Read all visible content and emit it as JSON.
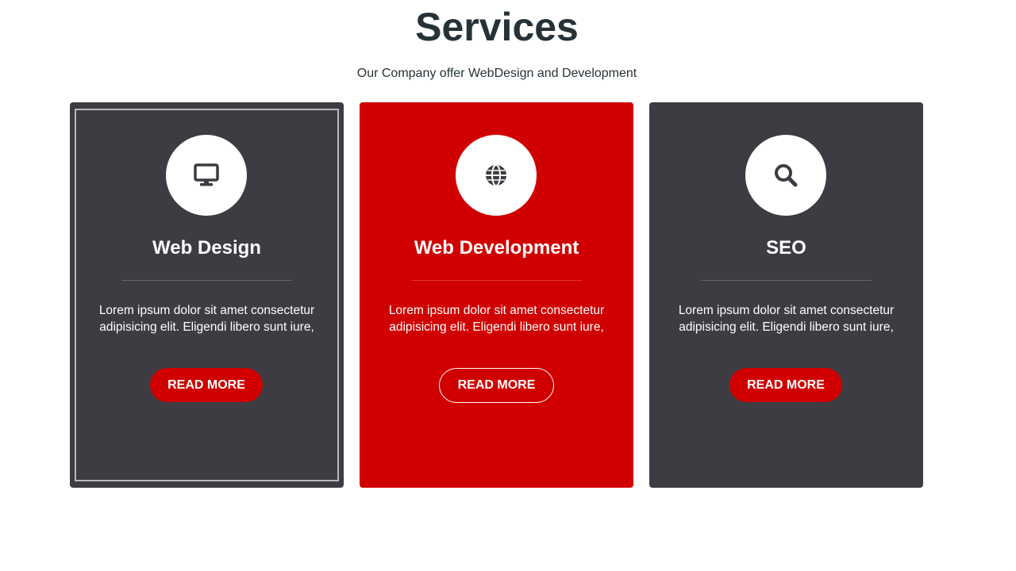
{
  "section": {
    "title": "Services",
    "subtitle": "Our Company offer WebDesign and Development"
  },
  "colors": {
    "dark_card": "#3d3c42",
    "accent": "#d10000",
    "heading": "#263238"
  },
  "cards": [
    {
      "icon": "desktop-icon",
      "title": "Web Design",
      "text": "Lorem ipsum dolor sit amet consectetur adipisicing elit. Eligendi libero sunt iure,",
      "button": "READ MORE"
    },
    {
      "icon": "globe-icon",
      "title": "Web Development",
      "text": "Lorem ipsum dolor sit amet consectetur adipisicing elit. Eligendi libero sunt iure,",
      "button": "READ MORE"
    },
    {
      "icon": "search-icon",
      "title": "SEO",
      "text": "Lorem ipsum dolor sit amet consectetur adipisicing elit. Eligendi libero sunt iure,",
      "button": "READ MORE"
    }
  ]
}
